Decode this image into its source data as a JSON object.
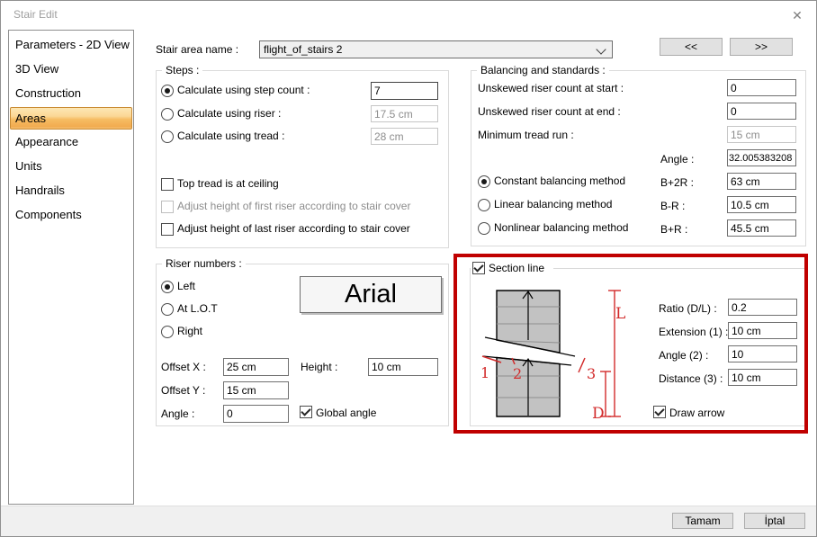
{
  "window": {
    "title": "Stair Edit",
    "close_glyph": "✕"
  },
  "sidebar": {
    "items": [
      "Parameters - 2D View",
      "3D View",
      "Construction",
      "Areas",
      "Appearance",
      "Units",
      "Handrails",
      "Components"
    ],
    "active_item": "Areas"
  },
  "header": {
    "label": "Stair area name :",
    "value": "flight_of_stairs 2",
    "prev": "<<",
    "next": ">>"
  },
  "steps": {
    "legend": "Steps :",
    "step_count": {
      "label": "Calculate using step count :",
      "value": "7",
      "selected": true,
      "enabled": true
    },
    "riser": {
      "label": "Calculate using riser :",
      "value": "17.5 cm",
      "selected": false,
      "enabled": false
    },
    "tread": {
      "label": "Calculate using tread :",
      "value": "28 cm",
      "selected": false,
      "enabled": false
    },
    "top_tread": {
      "label": "Top tread is at ceiling",
      "checked": false,
      "enabled": true
    },
    "adjust_first": {
      "label": "Adjust height of first riser according to stair cover",
      "checked": false,
      "enabled": false
    },
    "adjust_last": {
      "label": "Adjust height of last riser according to stair cover",
      "checked": false,
      "enabled": true
    }
  },
  "balancing": {
    "legend": "Balancing and standards :",
    "start": {
      "label": "Unskewed riser count at start :",
      "value": "0",
      "enabled": true
    },
    "end": {
      "label": "Unskewed riser count at end :",
      "value": "0",
      "enabled": true
    },
    "tread_run": {
      "label": "Minimum tread run :",
      "value": "15 cm",
      "enabled": false
    },
    "angle": {
      "label": "Angle :",
      "value": "32.005383208",
      "enabled": true
    },
    "constant": {
      "label": "Constant balancing method",
      "selected": true,
      "param": "B+2R :",
      "value": "63 cm"
    },
    "linear": {
      "label": "Linear balancing method",
      "selected": false,
      "param": "B-R :",
      "value": "10.5 cm"
    },
    "nonlinear": {
      "label": "Nonlinear balancing method",
      "selected": false,
      "param": "B+R :",
      "value": "45.5 cm"
    }
  },
  "riser_numbers": {
    "legend": "Riser numbers :",
    "left": {
      "label": "Left",
      "selected": true
    },
    "lot": {
      "label": "At L.O.T",
      "selected": false
    },
    "right": {
      "label": "Right",
      "selected": false
    },
    "font_button": "Arial",
    "offset_x": {
      "label": "Offset X :",
      "value": "25 cm"
    },
    "height": {
      "label": "Height :",
      "value": "10 cm"
    },
    "offset_y": {
      "label": "Offset Y :",
      "value": "15 cm"
    },
    "angle": {
      "label": "Angle :",
      "value": "0"
    },
    "global_angle": {
      "label": "Global angle",
      "checked": true
    }
  },
  "section": {
    "legend": "Section line",
    "legend_checked": true,
    "ratio": {
      "label": "Ratio (D/L) :",
      "value": "0.2"
    },
    "extension": {
      "label": "Extension (1) :",
      "value": "10 cm"
    },
    "angle": {
      "label": "Angle (2) :",
      "value": "10"
    },
    "distance": {
      "label": "Distance (3) :",
      "value": "10 cm"
    },
    "draw_arrow": {
      "label": "Draw arrow",
      "checked": true
    },
    "diagram": {
      "marker_1": "1",
      "marker_2": "2",
      "marker_3": "3",
      "dim_long": "L",
      "dim_short": "D"
    }
  },
  "footer": {
    "ok": "Tamam",
    "cancel": "İptal"
  },
  "colors": {
    "highlight_border": "#C00000",
    "annotation_red": "#D22A2A",
    "sidebar_active_top": "#FDE7B4",
    "sidebar_active_bottom": "#F2AB50",
    "sidebar_active_border": "#C98B33",
    "stair_fill": "#C2C2C2"
  }
}
